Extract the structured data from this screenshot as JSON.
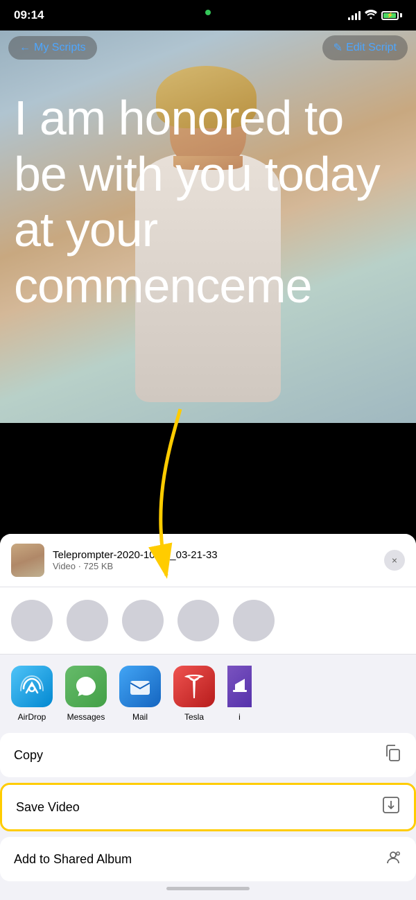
{
  "statusBar": {
    "time": "09:14",
    "greenDot": true
  },
  "nav": {
    "backLabel": "My Scripts",
    "editLabel": "Edit Script",
    "backArrow": "←",
    "editIcon": "✎"
  },
  "teleprompter": {
    "text": "I am honored to be with you today at your commenceme"
  },
  "filePreview": {
    "fileName": "Teleprompter-2020-10-12_03-21-33",
    "fileMeta": "Video · 725 KB",
    "closeLabel": "×"
  },
  "contacts": [
    {
      "name": ""
    },
    {
      "name": ""
    },
    {
      "name": ""
    },
    {
      "name": ""
    },
    {
      "name": ""
    }
  ],
  "apps": [
    {
      "id": "airdrop",
      "label": "AirDrop"
    },
    {
      "id": "messages",
      "label": "Messages"
    },
    {
      "id": "mail",
      "label": "Mail"
    },
    {
      "id": "tesla",
      "label": "Tesla"
    },
    {
      "id": "more",
      "label": "i"
    }
  ],
  "actions": [
    {
      "id": "copy",
      "label": "Copy",
      "icon": "copy"
    },
    {
      "id": "save-video",
      "label": "Save Video",
      "icon": "save",
      "highlighted": true
    },
    {
      "id": "add-shared-album",
      "label": "Add to Shared Album",
      "icon": "album"
    }
  ],
  "annotation": {
    "arrowColor": "#ffcc00"
  }
}
